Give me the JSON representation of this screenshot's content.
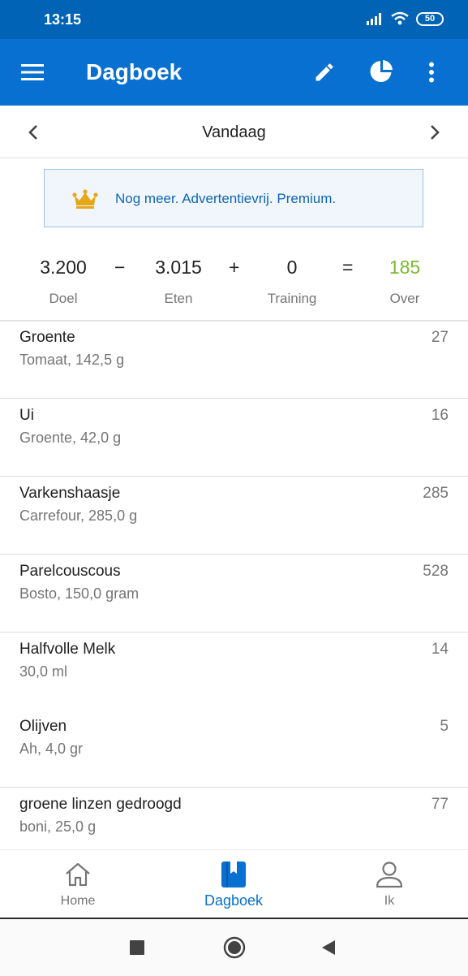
{
  "status": {
    "time": "13:15",
    "battery": "50"
  },
  "header": {
    "title": "Dagboek",
    "icons": [
      "menu-icon",
      "edit-icon",
      "pie-chart-icon",
      "more-icon"
    ]
  },
  "datebar": {
    "label": "Vandaag",
    "icons": [
      "chevron-left-icon",
      "chevron-right-icon"
    ]
  },
  "premium": {
    "text": "Nog meer. Advertentievrij. Premium.",
    "icon": "crown-icon"
  },
  "summary": {
    "goal": {
      "value": "3.200",
      "label": "Doel"
    },
    "op1": "−",
    "food": {
      "value": "3.015",
      "label": "Eten"
    },
    "op2": "+",
    "exercise": {
      "value": "0",
      "label": "Training"
    },
    "op3": "=",
    "remaining": {
      "value": "185",
      "label": "Over"
    },
    "remaining_color": "#7cb82f"
  },
  "entries": [
    {
      "name": "Groente",
      "detail": "Tomaat, 142,5 g",
      "calories": "27"
    },
    {
      "name": "Ui",
      "detail": "Groente, 42,0 g",
      "calories": "16"
    },
    {
      "name": "Varkenshaasje",
      "detail": "Carrefour, 285,0 g",
      "calories": "285"
    },
    {
      "name": "Parelcouscous",
      "detail": "Bosto, 150,0 gram",
      "calories": "528"
    },
    {
      "name": "Halfvolle Melk",
      "detail": "30,0 ml",
      "calories": "14"
    },
    {
      "name": "Olijven",
      "detail": "Ah, 4,0 gr",
      "calories": "5"
    },
    {
      "name": "groene linzen gedroogd",
      "detail": "boni, 25,0 g",
      "calories": "77"
    }
  ],
  "bottom_nav": [
    {
      "label": "Home",
      "icon": "home-icon"
    },
    {
      "label": "Dagboek",
      "icon": "diary-icon",
      "active": true
    },
    {
      "label": "Ik",
      "icon": "person-icon"
    }
  ],
  "colors": {
    "status_bar": "#0063b6",
    "app_bar": "#0770d0",
    "accent": "#0770d0",
    "premium_text": "#0f66b7",
    "crown": "#e6a817"
  }
}
